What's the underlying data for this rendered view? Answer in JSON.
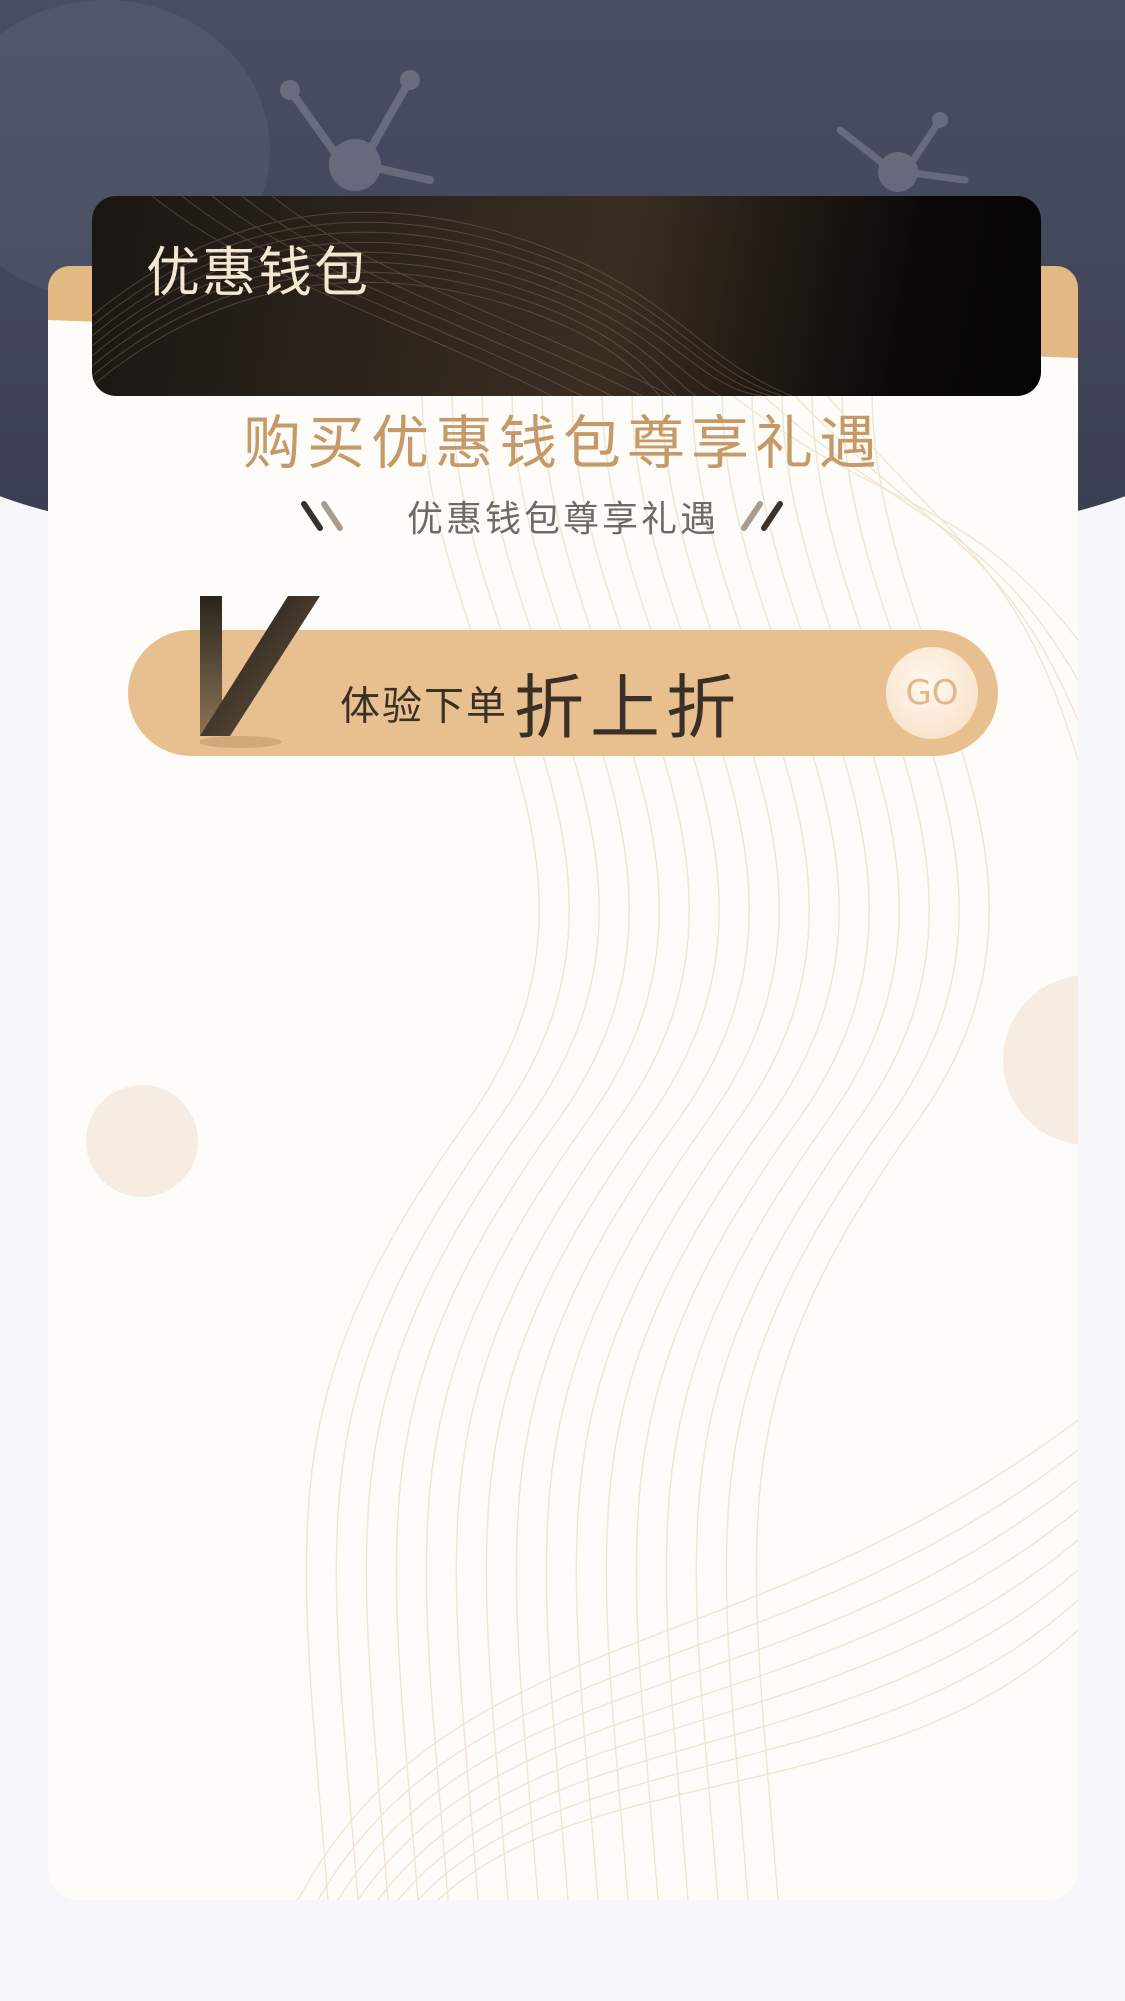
{
  "card": {
    "title": "优惠钱包"
  },
  "main": {
    "headline": "购买优惠钱包尊享礼遇",
    "subline": "优惠钱包尊享礼遇"
  },
  "promo": {
    "small_text": "体验下单",
    "big_text": "折上折",
    "go_label": "GO"
  },
  "colors": {
    "dark_bg": "#464a60",
    "gold": "#e2b883",
    "gold_text": "#c59a68",
    "card_bg": "#fdfcf8",
    "page_bg": "#f6f6fb"
  },
  "icons": [
    "molecule-icon",
    "slash-decor-icon",
    "v-badge-icon"
  ]
}
